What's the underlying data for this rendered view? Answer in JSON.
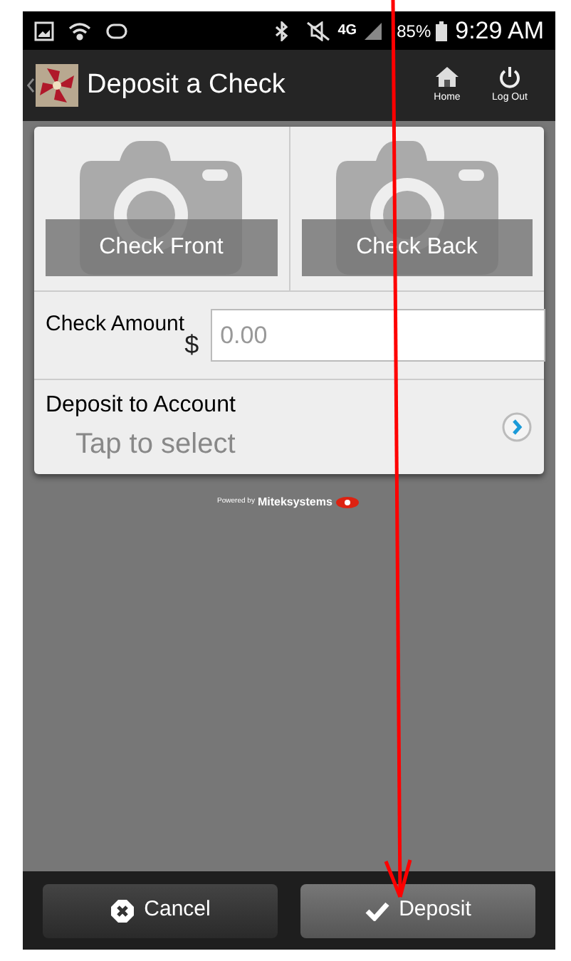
{
  "status_bar": {
    "network": "4G",
    "battery": "85%",
    "time": "9:29 AM"
  },
  "app_bar": {
    "title": "Deposit a Check",
    "actions": [
      {
        "kind": "home",
        "label": "Home"
      },
      {
        "kind": "logout",
        "label": "Log Out"
      }
    ]
  },
  "capture": [
    {
      "label": "Check Front"
    },
    {
      "label": "Check Back"
    }
  ],
  "amount": {
    "label": "Check Amount",
    "currency": "$",
    "placeholder": "0.00"
  },
  "account": {
    "label": "Deposit to Account",
    "hint": "Tap to select"
  },
  "powered_by": {
    "prefix": "Powered by",
    "brand": "Miteksystems"
  },
  "buttons": [
    {
      "kind": "cancel",
      "label": "Cancel"
    },
    {
      "kind": "deposit",
      "label": "Deposit"
    }
  ]
}
